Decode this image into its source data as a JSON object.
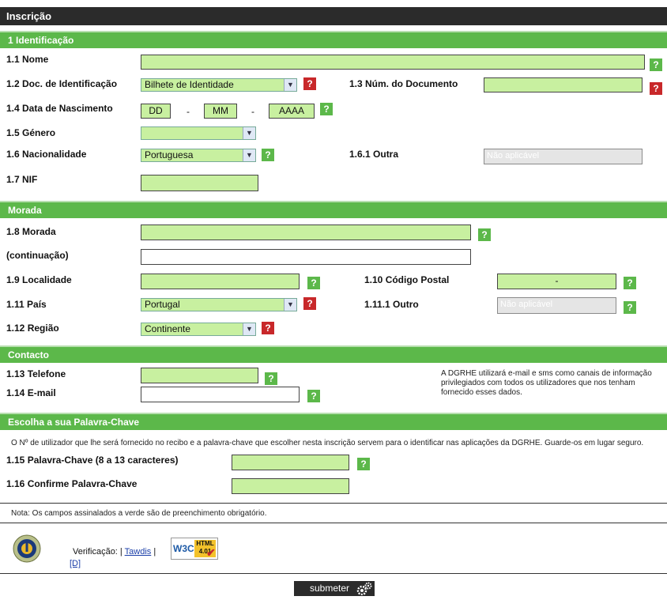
{
  "title": "Inscrição",
  "sections": {
    "ident": "1 Identificação",
    "morada": "Morada",
    "contacto": "Contacto",
    "palavra": "Escolha a sua Palavra-Chave"
  },
  "labels": {
    "nome": "1.1 Nome",
    "doc": "1.2 Doc. de Identificação",
    "numdoc": "1.3 Núm. do Documento",
    "nasc": "1.4 Data de Nascimento",
    "genero": "1.5 Género",
    "nacionalidade": "1.6 Nacionalidade",
    "outra": "1.6.1 Outra",
    "nif": "1.7 NIF",
    "morada": "1.8 Morada",
    "continuacao": "(continuação)",
    "localidade": "1.9 Localidade",
    "codpostal": "1.10 Código Postal",
    "pais": "1.11 País",
    "outro": "1.11.1 Outro",
    "regiao": "1.12 Região",
    "telefone": "1.13 Telefone",
    "email": "1.14 E-mail",
    "palavra": "1.15 Palavra-Chave (8 a 13 caracteres)",
    "confirme": "1.16 Confirme Palavra-Chave"
  },
  "values": {
    "doc_select": "Bilhete de Identidade",
    "dd": "DD",
    "mm": "MM",
    "aaaa": "AAAA",
    "date_sep": "-",
    "nacionalidade_select": "Portuguesa",
    "outra_placeholder": "Não aplicável",
    "codpostal_sep": "-",
    "pais_select": "Portugal",
    "outro_placeholder": "Não aplicável",
    "regiao_select": "Continente"
  },
  "help_glyph": "?",
  "contact_note": "A DGRHE utilizará e-mail e sms como canais de informação privilegiados com todos os utilizadores que nos tenham fornecido esses dados.",
  "palavra_note": "O Nº de utilizador que lhe será fornecido no recibo e a palavra-chave que escolher nesta inscrição servem para o identificar nas aplicações da DGRHE. Guarde-os em lugar seguro.",
  "nota": "Nota: Os campos assinalados a verde são de preenchimento obrigatório.",
  "footer": {
    "verificacao": "Verificação: |",
    "tawdis": "Tawdis",
    "pipe": "|",
    "d_link": "[D]",
    "w3c_badge": "W3C",
    "html_badge": "HTML",
    "html_version": "4.01"
  },
  "submit_label": "submeter",
  "colors": {
    "green": "#5cb84a",
    "field_green": "#c8f0a0",
    "help_red": "#c8282a",
    "dark": "#2b2b2b"
  },
  "icons": [
    "help-icon",
    "gears-icon",
    "accessibility-logo",
    "w3c-html-badge"
  ]
}
